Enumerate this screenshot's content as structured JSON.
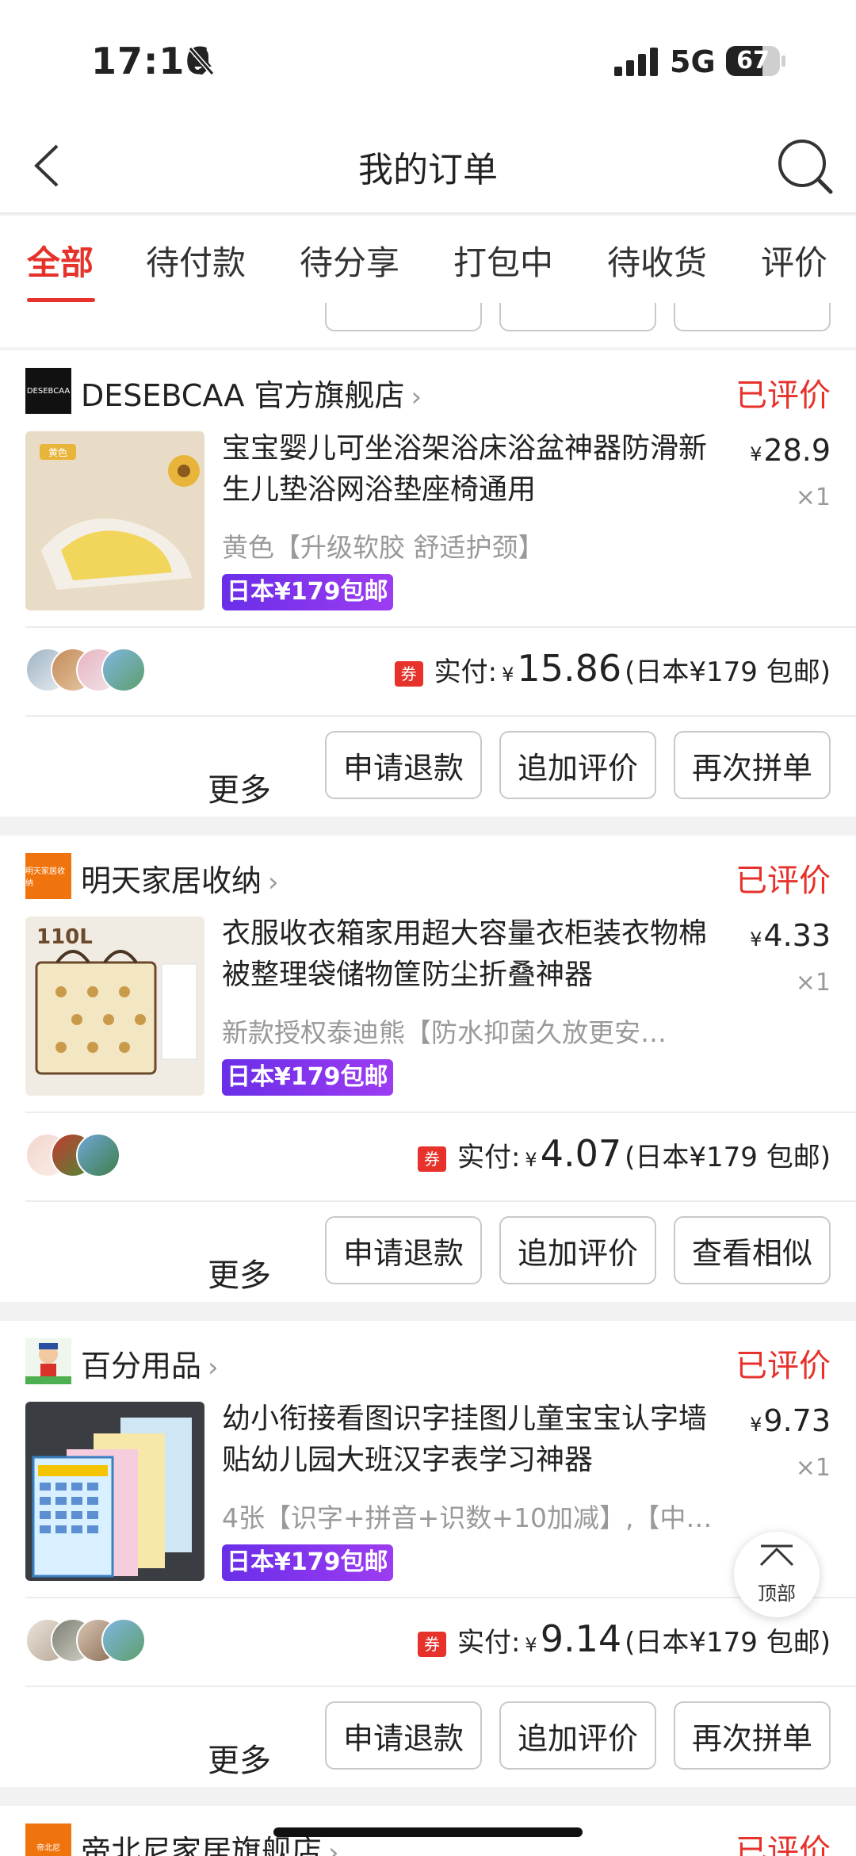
{
  "status_bar": {
    "time": "17:16",
    "network": "5G",
    "battery": "67",
    "battery_level": 0.67
  },
  "nav": {
    "title": "我的订单"
  },
  "tabs": [
    "全部",
    "待付款",
    "待分享",
    "打包中",
    "待收货",
    "评价"
  ],
  "active_tab": "全部",
  "orders": [
    {
      "shop_logo_text": "DESEBCAA",
      "shop_name": "DESEBCAA 官方旗舰店",
      "status": "已评价",
      "thumb_tag": "黄色",
      "title": "宝宝婴儿可坐浴架浴床浴盆神器防滑新生儿垫浴网浴垫座椅通用",
      "price_symbol": "¥",
      "price": "28.9",
      "qty": "×1",
      "spec": "黄色【升级软胶 舒适护颈】",
      "promo": "日本¥179包邮",
      "coupon": "券",
      "paid_label": "实付:",
      "paid_symbol": "¥",
      "paid_amount": "15.86",
      "paid_note": "(日本¥179 包邮)",
      "more": "更多",
      "buttons": [
        "申请退款",
        "追加评价",
        "再次拼单"
      ]
    },
    {
      "shop_logo_text": "明天家居收纳",
      "shop_name": "明天家居收纳",
      "status": "已评价",
      "thumb_tag": "110L",
      "title": "衣服收衣箱家用超大容量衣柜装衣物棉被整理袋储物筐防尘折叠神器",
      "price_symbol": "¥",
      "price": "4.33",
      "qty": "×1",
      "spec": "新款授权泰迪熊【防水抑菌久放更安…",
      "promo": "日本¥179包邮",
      "coupon": "券",
      "paid_label": "实付:",
      "paid_symbol": "¥",
      "paid_amount": "4.07",
      "paid_note": "(日本¥179 包邮)",
      "more": "更多",
      "buttons": [
        "申请退款",
        "追加评价",
        "查看相似"
      ]
    },
    {
      "shop_logo_text": "百分用品",
      "shop_name": "百分用品",
      "status": "已评价",
      "thumb_tag": "",
      "title": "幼小衔接看图识字挂图儿童宝宝认字墙贴幼儿园大班汉字表学习神器",
      "price_symbol": "¥",
      "price": "9.73",
      "qty": "×1",
      "spec": "4张【识字+拼音+识数+10加减】,【中…",
      "promo": "日本¥179包邮",
      "coupon": "券",
      "paid_label": "实付:",
      "paid_symbol": "¥",
      "paid_amount": "9.14",
      "paid_note": "(日本¥179 包邮)",
      "more": "更多",
      "buttons": [
        "申请退款",
        "追加评价",
        "再次拼单"
      ]
    },
    {
      "shop_logo_text": "帝北尼",
      "shop_name": "帝北尼家居旗舰店",
      "status": "已评价"
    }
  ],
  "back_to_top": "顶部",
  "colors": {
    "accent": "#e6322b",
    "promo": "#7b33ec"
  },
  "icons": [
    "bell-muted-icon",
    "signal-icon",
    "battery-icon",
    "back-chevron-icon",
    "search-icon",
    "coupon-icon",
    "chevron-right-icon",
    "arrow-up-icon"
  ]
}
